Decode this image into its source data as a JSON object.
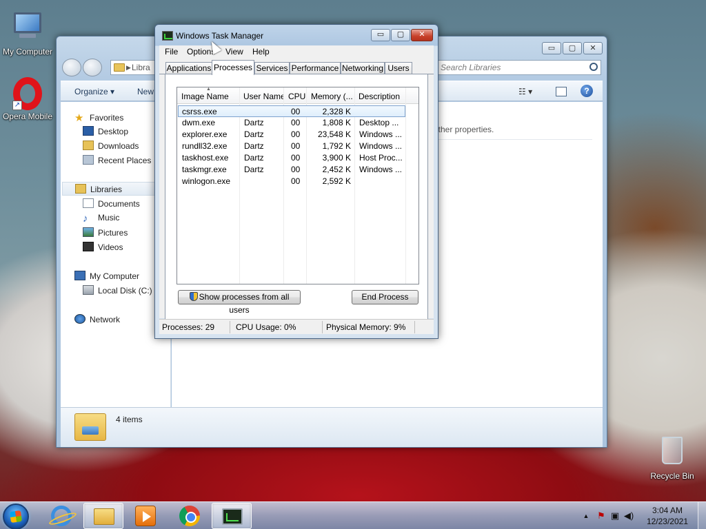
{
  "desktop": {
    "icons": [
      {
        "label": "My Computer",
        "icon": "computer-icon"
      },
      {
        "label": "Opera Mobile",
        "icon": "opera-icon"
      },
      {
        "label": "Recycle Bin",
        "icon": "recycle-bin-icon"
      }
    ]
  },
  "explorer": {
    "address": "Libra",
    "search_placeholder": "Search Libraries",
    "toolbar": {
      "organize": "Organize ▾",
      "new": "New"
    },
    "content_hint": "other properties.",
    "nav": {
      "favorites": "Favorites",
      "desktop": "Desktop",
      "downloads": "Downloads",
      "recent": "Recent Places",
      "libraries": "Libraries",
      "documents": "Documents",
      "music": "Music",
      "pictures": "Pictures",
      "videos": "Videos",
      "my_computer": "My Computer",
      "local_disk": "Local Disk (C:)",
      "network": "Network"
    },
    "details": {
      "count": "4 items"
    },
    "caption": {
      "minimize": "▭",
      "maximize": "▢",
      "close": "✕"
    }
  },
  "taskmgr": {
    "title": "Windows Task Manager",
    "menu": {
      "file": "File",
      "options": "Options",
      "view": "View",
      "help": "Help"
    },
    "tabs": {
      "applications": "Applications",
      "processes": "Processes",
      "services": "Services",
      "performance": "Performance",
      "networking": "Networking",
      "users": "Users"
    },
    "columns": {
      "image": "Image Name",
      "user": "User Name",
      "cpu": "CPU",
      "memory": "Memory (...",
      "description": "Description"
    },
    "rows": [
      {
        "image": "csrss.exe",
        "user": "",
        "cpu": "00",
        "memory": "2,328 K",
        "description": ""
      },
      {
        "image": "dwm.exe",
        "user": "Dartz",
        "cpu": "00",
        "memory": "1,808 K",
        "description": "Desktop ..."
      },
      {
        "image": "explorer.exe",
        "user": "Dartz",
        "cpu": "00",
        "memory": "23,548 K",
        "description": "Windows ..."
      },
      {
        "image": "rundll32.exe",
        "user": "Dartz",
        "cpu": "00",
        "memory": "1,792 K",
        "description": "Windows ..."
      },
      {
        "image": "taskhost.exe",
        "user": "Dartz",
        "cpu": "00",
        "memory": "3,900 K",
        "description": "Host Proc..."
      },
      {
        "image": "taskmgr.exe",
        "user": "Dartz",
        "cpu": "00",
        "memory": "2,452 K",
        "description": "Windows ..."
      },
      {
        "image": "winlogon.exe",
        "user": "",
        "cpu": "00",
        "memory": "2,592 K",
        "description": ""
      }
    ],
    "buttons": {
      "show_all": "Show processes from all users",
      "end_process": "End Process"
    },
    "status": {
      "processes": "Processes: 29",
      "cpu": "CPU Usage: 0%",
      "memory": "Physical Memory: 9%"
    },
    "caption": {
      "minimize": "▭",
      "maximize": "▢",
      "close": "✕"
    }
  },
  "taskbar": {
    "apps": [
      "internet-explorer",
      "windows-explorer",
      "media-player",
      "chrome",
      "task-manager"
    ],
    "tray": {
      "time": "3:04 AM",
      "date": "12/23/2021"
    }
  }
}
